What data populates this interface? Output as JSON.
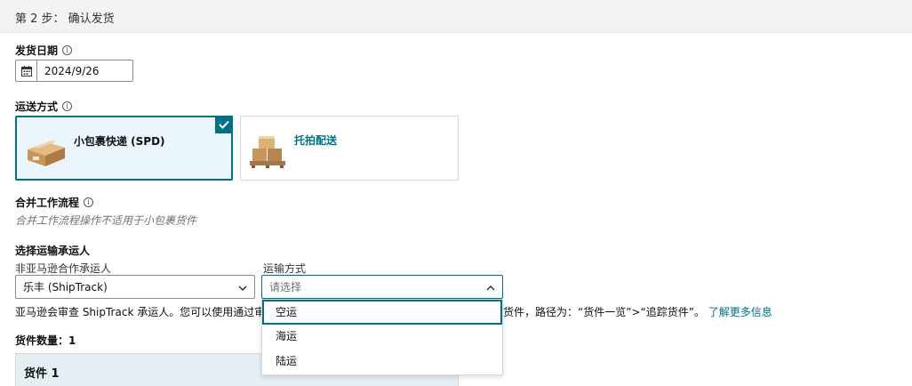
{
  "header": {
    "step": "第 2 步： 确认发货"
  },
  "ship_date": {
    "label": "发货日期",
    "value": "2024/9/26"
  },
  "shipping_method": {
    "label": "运送方式",
    "options": [
      {
        "label": "小包裹快递 (SPD)",
        "selected": true
      },
      {
        "label": "托拍配送",
        "selected": false
      }
    ]
  },
  "merge_workflow": {
    "label": "合并工作流程",
    "hint": "合并工作流程操作不适用于小包裹货件"
  },
  "carrier": {
    "label": "选择运输承运人",
    "non_partner_label": "非亚马逊合作承运人",
    "non_partner_value": "乐丰 (ShipTrack)",
    "mode_label": "运输方式",
    "mode_placeholder": "请选择",
    "mode_options": [
      "空运",
      "海运",
      "陆运"
    ]
  },
  "notice": {
    "left": "亚马逊会审查 ShipTrack 承运人。您可以使用通过审查",
    "right": "货件，路径为：“货件一览”>“追踪货件”。",
    "link": "了解更多信息"
  },
  "shipments": {
    "count_label": "货件数量：1",
    "first": "货件 1"
  },
  "colors": {
    "accent": "#007185",
    "selected_bg": "#eaf6fb"
  }
}
